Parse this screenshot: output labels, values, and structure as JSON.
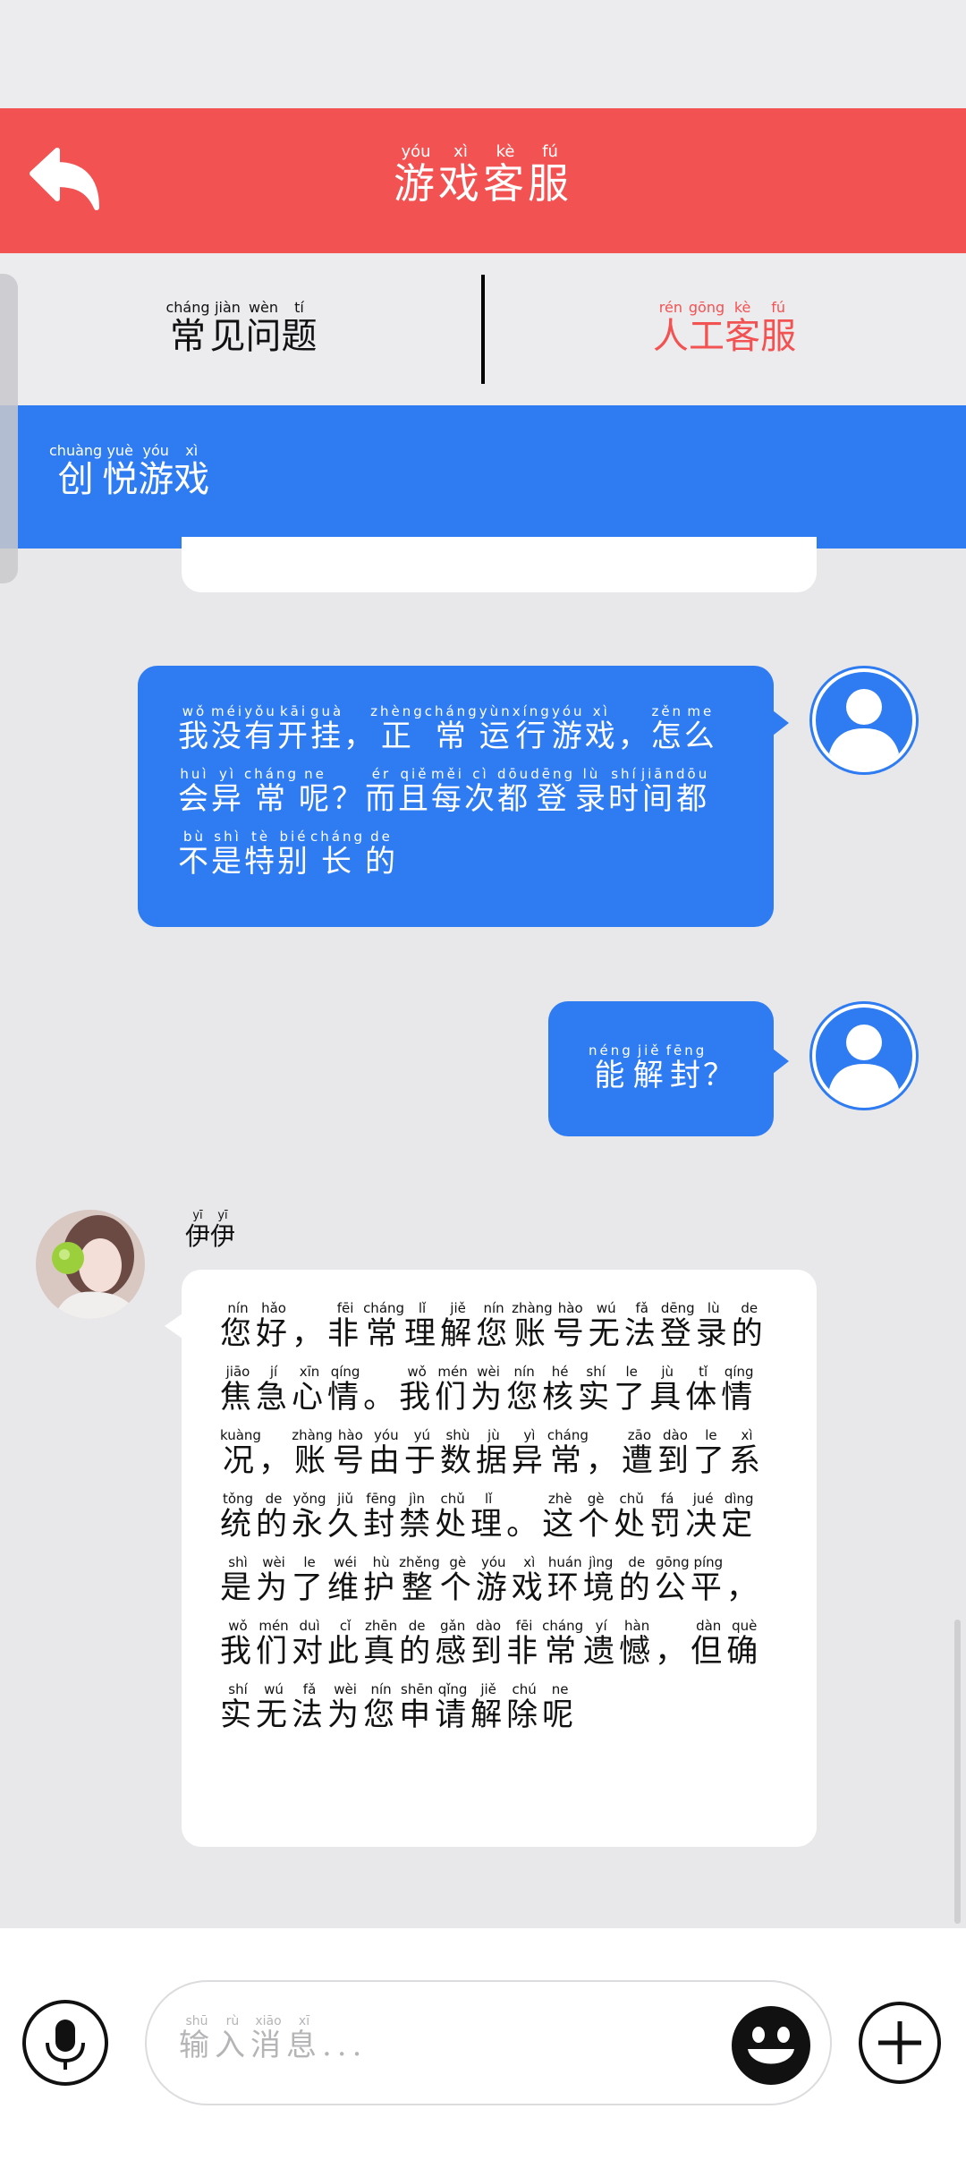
{
  "header": {
    "title_chars": [
      [
        "游",
        "yóu"
      ],
      [
        "戏",
        "xì"
      ],
      [
        "客",
        "kè"
      ],
      [
        "服",
        "fú"
      ]
    ]
  },
  "tabs": {
    "faq_chars": [
      [
        "常",
        "cháng"
      ],
      [
        "见",
        "jiàn"
      ],
      [
        "问",
        "wèn"
      ],
      [
        "题",
        "tí"
      ]
    ],
    "human_chars": [
      [
        "人",
        "rén"
      ],
      [
        "工",
        "gōng"
      ],
      [
        "客",
        "kè"
      ],
      [
        "服",
        "fú"
      ]
    ]
  },
  "banner": {
    "chars": [
      [
        "创",
        "chuàng"
      ],
      [
        "悦",
        "yuè"
      ],
      [
        "游",
        "yóu"
      ],
      [
        "戏",
        "xì"
      ]
    ]
  },
  "messages": [
    {
      "sender": "user",
      "chars": [
        [
          "我",
          "wǒ"
        ],
        [
          "没",
          "méi"
        ],
        [
          "有",
          "yǒu"
        ],
        [
          "开",
          "kāi"
        ],
        [
          "挂",
          "guà"
        ],
        [
          "，",
          ""
        ],
        [
          "正",
          "zhèng"
        ],
        [
          "常",
          "cháng"
        ],
        [
          "运",
          "yùn"
        ],
        [
          "行",
          "xíng"
        ],
        [
          "游",
          "yóu"
        ],
        [
          "戏",
          "xì"
        ],
        [
          "，",
          ""
        ],
        [
          "怎",
          "zěn"
        ],
        [
          "么",
          "me"
        ],
        [
          "会",
          "huì"
        ],
        [
          "异",
          "yì"
        ],
        [
          "常",
          "cháng"
        ],
        [
          "呢",
          "ne"
        ],
        [
          "？",
          ""
        ],
        [
          "而",
          "ér"
        ],
        [
          "且",
          "qiě"
        ],
        [
          "每",
          "měi"
        ],
        [
          "次",
          "cì"
        ],
        [
          "都",
          "dōu"
        ],
        [
          "登",
          "dēng"
        ],
        [
          "录",
          "lù"
        ],
        [
          "时",
          "shí"
        ],
        [
          "间",
          "jiān"
        ],
        [
          "都",
          "dōu"
        ],
        [
          "不",
          "bù"
        ],
        [
          "是",
          "shì"
        ],
        [
          "特",
          "tè"
        ],
        [
          "别",
          "bié"
        ],
        [
          "长",
          "cháng"
        ],
        [
          "的",
          "de"
        ]
      ]
    },
    {
      "sender": "user",
      "chars": [
        [
          "能",
          "néng"
        ],
        [
          "解",
          "jiě"
        ],
        [
          "封",
          "fēng"
        ],
        [
          "？",
          ""
        ]
      ]
    }
  ],
  "agent": {
    "name_chars": [
      [
        "伊",
        "yī"
      ],
      [
        "伊",
        "yī"
      ]
    ],
    "reply_chars": [
      [
        "您",
        "nín"
      ],
      [
        "好",
        "hǎo"
      ],
      [
        "，",
        ""
      ],
      [
        "非",
        "fēi"
      ],
      [
        "常",
        "cháng"
      ],
      [
        "理",
        "lǐ"
      ],
      [
        "解",
        "jiě"
      ],
      [
        "您",
        "nín"
      ],
      [
        "账",
        "zhàng"
      ],
      [
        "号",
        "hào"
      ],
      [
        "无",
        "wú"
      ],
      [
        "法",
        "fǎ"
      ],
      [
        "登",
        "dēng"
      ],
      [
        "录",
        "lù"
      ],
      [
        "的",
        "de"
      ],
      [
        "焦",
        "jiāo"
      ],
      [
        "急",
        "jí"
      ],
      [
        "心",
        "xīn"
      ],
      [
        "情",
        "qíng"
      ],
      [
        "。",
        ""
      ],
      [
        "我",
        "wǒ"
      ],
      [
        "们",
        "mén"
      ],
      [
        "为",
        "wèi"
      ],
      [
        "您",
        "nín"
      ],
      [
        "核",
        "hé"
      ],
      [
        "实",
        "shí"
      ],
      [
        "了",
        "le"
      ],
      [
        "具",
        "jù"
      ],
      [
        "体",
        "tǐ"
      ],
      [
        "情",
        "qíng"
      ],
      [
        "况",
        "kuàng"
      ],
      [
        "，",
        ""
      ],
      [
        "账",
        "zhàng"
      ],
      [
        "号",
        "hào"
      ],
      [
        "由",
        "yóu"
      ],
      [
        "于",
        "yú"
      ],
      [
        "数",
        "shù"
      ],
      [
        "据",
        "jù"
      ],
      [
        "异",
        "yì"
      ],
      [
        "常",
        "cháng"
      ],
      [
        "，",
        ""
      ],
      [
        "遭",
        "zāo"
      ],
      [
        "到",
        "dào"
      ],
      [
        "了",
        "le"
      ],
      [
        "系",
        "xì"
      ],
      [
        "统",
        "tǒng"
      ],
      [
        "的",
        "de"
      ],
      [
        "永",
        "yǒng"
      ],
      [
        "久",
        "jiǔ"
      ],
      [
        "封",
        "fēng"
      ],
      [
        "禁",
        "jìn"
      ],
      [
        "处",
        "chǔ"
      ],
      [
        "理",
        "lǐ"
      ],
      [
        "。",
        ""
      ],
      [
        "这",
        "zhè"
      ],
      [
        "个",
        "gè"
      ],
      [
        "处",
        "chǔ"
      ],
      [
        "罚",
        "fá"
      ],
      [
        "决",
        "jué"
      ],
      [
        "定",
        "dìng"
      ],
      [
        "是",
        "shì"
      ],
      [
        "为",
        "wèi"
      ],
      [
        "了",
        "le"
      ],
      [
        "维",
        "wéi"
      ],
      [
        "护",
        "hù"
      ],
      [
        "整",
        "zhěng"
      ],
      [
        "个",
        "gè"
      ],
      [
        "游",
        "yóu"
      ],
      [
        "戏",
        "xì"
      ],
      [
        "环",
        "huán"
      ],
      [
        "境",
        "jìng"
      ],
      [
        "的",
        "de"
      ],
      [
        "公",
        "gōng"
      ],
      [
        "平",
        "píng"
      ],
      [
        "，",
        ""
      ],
      [
        "我",
        "wǒ"
      ],
      [
        "们",
        "mén"
      ],
      [
        "对",
        "duì"
      ],
      [
        "此",
        "cǐ"
      ],
      [
        "真",
        "zhēn"
      ],
      [
        "的",
        "de"
      ],
      [
        "感",
        "gǎn"
      ],
      [
        "到",
        "dào"
      ],
      [
        "非",
        "fēi"
      ],
      [
        "常",
        "cháng"
      ],
      [
        "遗",
        "yí"
      ],
      [
        "憾",
        "hàn"
      ],
      [
        "，",
        ""
      ],
      [
        "但",
        "dàn"
      ],
      [
        "确",
        "què"
      ],
      [
        "实",
        "shí"
      ],
      [
        "无",
        "wú"
      ],
      [
        "法",
        "fǎ"
      ],
      [
        "为",
        "wèi"
      ],
      [
        "您",
        "nín"
      ],
      [
        "申",
        "shēn"
      ],
      [
        "请",
        "qǐng"
      ],
      [
        "解",
        "jiě"
      ],
      [
        "除",
        "chú"
      ],
      [
        "呢",
        "ne"
      ]
    ]
  },
  "input": {
    "placeholder_chars": [
      [
        "输",
        "shū"
      ],
      [
        "入",
        "rù"
      ],
      [
        "消",
        "xiāo"
      ],
      [
        "息",
        "xī"
      ],
      [
        "...",
        ""
      ]
    ]
  },
  "icons": {
    "back": "back-arrow-icon",
    "mic": "microphone-icon",
    "emoji": "emoji-icon",
    "plus": "plus-icon",
    "user_avatar": "user-avatar-icon"
  },
  "colors": {
    "header": "#f35252",
    "accent_blue": "#2f7cf2",
    "human_tab": "#f35252",
    "background": "#e8e8ea"
  }
}
